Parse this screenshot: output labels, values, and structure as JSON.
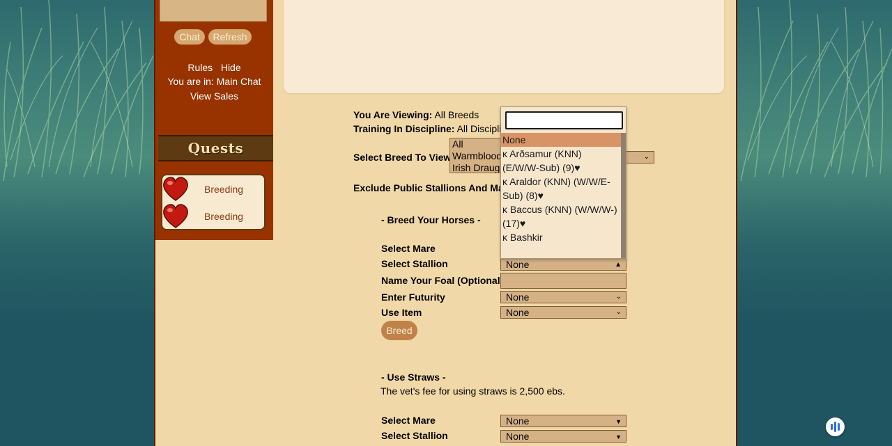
{
  "sidebar": {
    "chat_button": "Chat",
    "refresh_button": "Refresh",
    "rules_link": "Rules",
    "hide_link": "Hide",
    "location_text": "You are in: Main Chat",
    "view_sales_link": "View Sales",
    "quests_title": "Quests",
    "quests": [
      {
        "label": "Breeding",
        "icon": "heart-icon"
      },
      {
        "label": "Breeding",
        "icon": "heart-icon"
      }
    ]
  },
  "filters": {
    "viewing_label": "You Are Viewing:",
    "viewing_value": "All Breeds",
    "discipline_label": "Training In Discipline:",
    "discipline_value": "All Disciplin",
    "select_breed_label": "Select Breed To View",
    "breed_options": [
      "All",
      "Warmblood",
      "Irish Draugh"
    ],
    "exclude_label": "Exclude Public Stallions And Mar"
  },
  "breed_section": {
    "title": "- Breed Your Horses -",
    "select_mare_label": "Select Mare",
    "select_stallion_label": "Select Stallion",
    "stallion_value": "None",
    "foal_name_label": "Name Your Foal (Optional)",
    "foal_name_value": "",
    "futurity_label": "Enter Futurity",
    "futurity_value": "None",
    "use_item_label": "Use Item",
    "use_item_value": "None",
    "breed_button": "Breed"
  },
  "straws_section": {
    "title": "- Use Straws -",
    "fee_text": "The vet's fee for using straws is 2,500 ebs.",
    "select_mare_label": "Select Mare",
    "mare_value": "None",
    "select_stallion_label": "Select Stallion",
    "stallion_value": "None"
  },
  "dropdown": {
    "search_value": "",
    "options": [
      {
        "text": "None",
        "highlighted": true
      },
      {
        "text": "ĸ Arðsamur (KNN)  (E/W/W-Sub) (9)♥",
        "highlighted": false
      },
      {
        "text": "ĸ Araldor (KNN)  (W/W/E-Sub) (8)♥",
        "highlighted": false
      },
      {
        "text": "ĸ Baccus (KNN)  (W/W/W-) (17)♥",
        "highlighted": false
      },
      {
        "text": "ĸ Bashkir",
        "highlighted": false
      }
    ]
  },
  "colors": {
    "sidebar": "#983300",
    "page_bg": "#f1d8a8",
    "panel": "#f8ead5",
    "highlight": "#d89466",
    "control": "#d5b285"
  }
}
